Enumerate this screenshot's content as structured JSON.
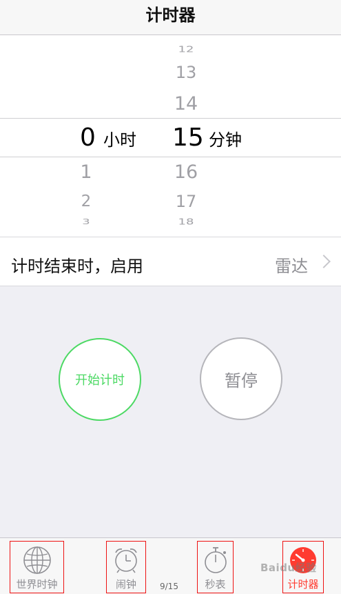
{
  "nav": {
    "title": "计时器"
  },
  "picker": {
    "hours": {
      "above": [],
      "selected": "0",
      "below": [
        "1",
        "2",
        "3"
      ],
      "unit": "小时"
    },
    "minutes": {
      "above": [
        "12",
        "13",
        "14"
      ],
      "selected": "15",
      "below": [
        "16",
        "17",
        "18"
      ],
      "unit": "分钟"
    }
  },
  "sound_row": {
    "label": "计时结束时，启用",
    "value": "雷达"
  },
  "buttons": {
    "start": "开始计时",
    "pause": "暂停"
  },
  "tabbar": {
    "items": [
      {
        "label": "世界时钟",
        "icon": "globe-icon"
      },
      {
        "label": "闹钟",
        "icon": "alarm-clock-icon"
      },
      {
        "label": "秒表",
        "icon": "stopwatch-icon"
      },
      {
        "label": "计时器",
        "icon": "timer-icon",
        "active": true
      }
    ]
  },
  "page_counter": "9/15",
  "watermark": "Baidu经验",
  "colors": {
    "green": "#4cd964",
    "red": "#ff3b30",
    "gray": "#8e8e93"
  }
}
